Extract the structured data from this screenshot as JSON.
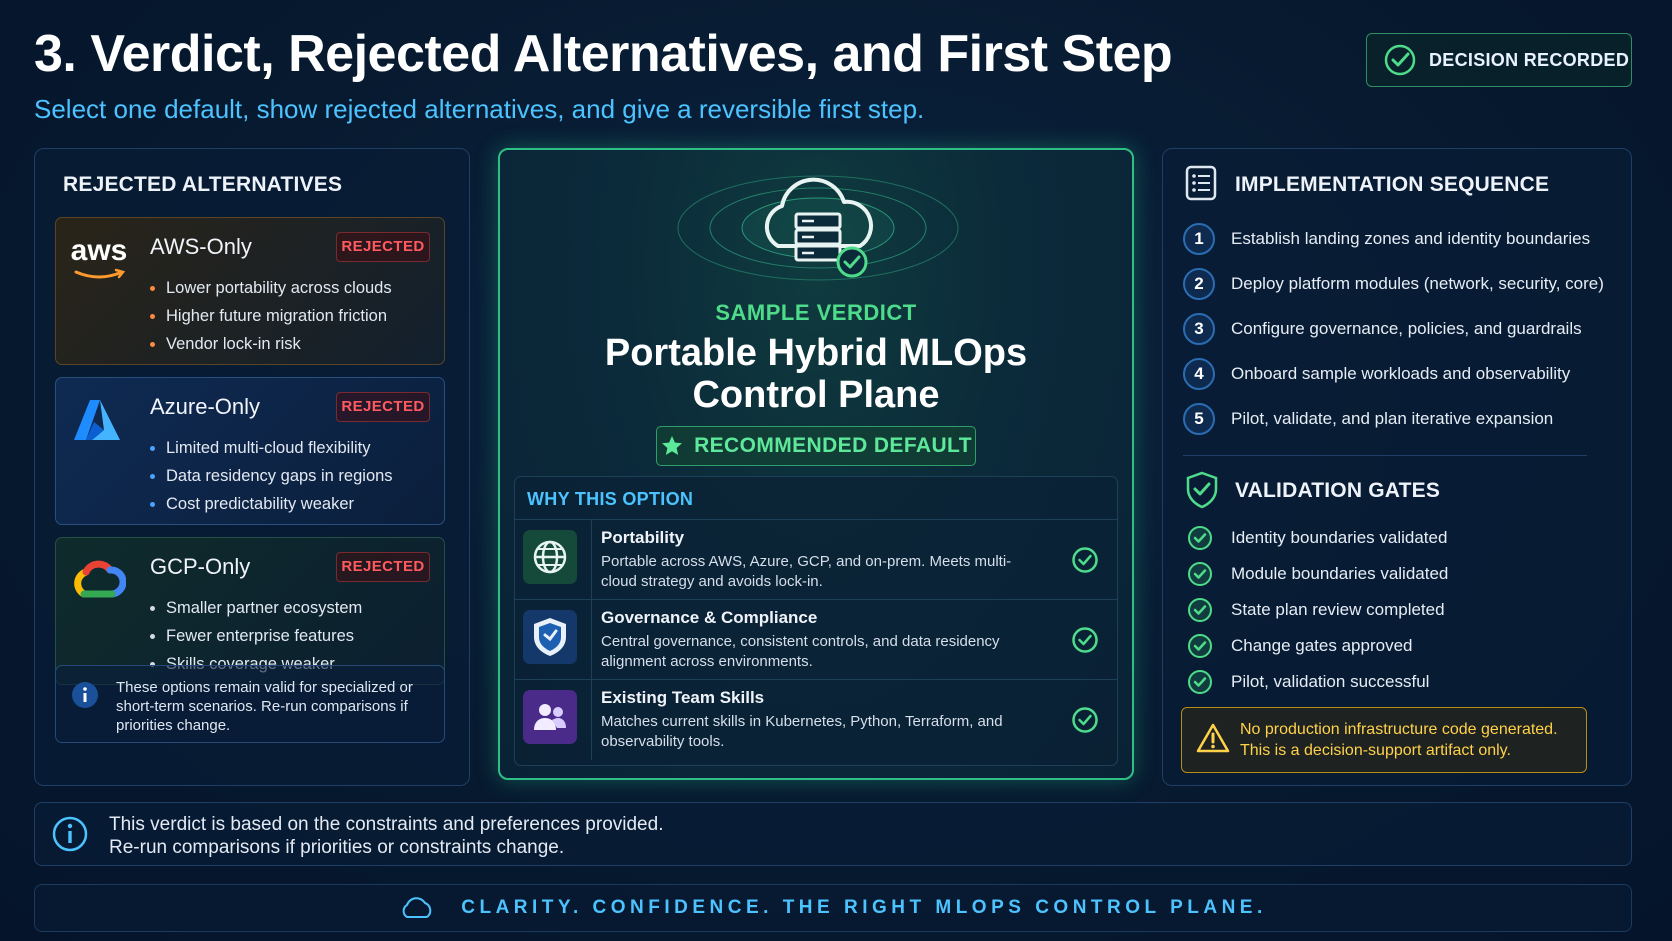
{
  "header": {
    "title": "3. Verdict, Rejected Alternatives, and First Step",
    "subtitle": "Select one default, show rejected alternatives, and give a reversible first step.",
    "badge": "DECISION RECORDED"
  },
  "rejected": {
    "title": "REJECTED ALTERNATIVES",
    "tag": "REJECTED",
    "cards": [
      {
        "logo_text": "aws",
        "name": "AWS-Only",
        "bullets": [
          "Lower portability across clouds",
          "Higher future migration friction",
          "Vendor lock-in risk"
        ]
      },
      {
        "name": "Azure-Only",
        "bullets": [
          "Limited multi-cloud flexibility",
          "Data residency gaps in regions",
          "Cost predictability weaker"
        ]
      },
      {
        "name": "GCP-Only",
        "bullets": [
          "Smaller partner ecosystem",
          "Fewer enterprise features",
          "Skills coverage weaker"
        ]
      }
    ],
    "note": "These options remain valid for specialized or short-term scenarios. Re-run comparisons if priorities change."
  },
  "verdict": {
    "label": "SAMPLE VERDICT",
    "title_line1": "Portable Hybrid MLOps",
    "title_line2": "Control Plane",
    "recommended": "RECOMMENDED DEFAULT",
    "why_title": "WHY THIS OPTION",
    "reasons": [
      {
        "icon": "globe-icon",
        "name": "Portability",
        "desc": "Portable across AWS, Azure, GCP, and on-prem. Meets multi-cloud strategy and avoids lock-in."
      },
      {
        "icon": "shield-icon",
        "name": "Governance & Compliance",
        "desc": "Central governance, consistent controls, and data residency alignment across environments."
      },
      {
        "icon": "team-icon",
        "name": "Existing Team Skills",
        "desc": "Matches current skills in Kubernetes, Python, Terraform, and observability tools."
      }
    ]
  },
  "implementation": {
    "title": "IMPLEMENTATION SEQUENCE",
    "steps": [
      {
        "num": "1",
        "text": "Establish landing zones and identity boundaries"
      },
      {
        "num": "2",
        "text": "Deploy platform modules (network, security, core)"
      },
      {
        "num": "3",
        "text": "Configure governance, policies, and guardrails"
      },
      {
        "num": "4",
        "text": "Onboard sample workloads and observability"
      },
      {
        "num": "5",
        "text": "Pilot, validate, and plan iterative expansion"
      }
    ]
  },
  "gates": {
    "title": "VALIDATION GATES",
    "items": [
      "Identity boundaries validated",
      "Module boundaries validated",
      "State plan review completed",
      "Change gates approved",
      "Pilot, validation successful"
    ]
  },
  "warning": {
    "line1": "No production infrastructure code generated.",
    "line2": "This is a decision-support artifact only."
  },
  "footer": {
    "info_line1": "This verdict is based on the constraints and preferences provided.",
    "info_line2": "Re-run comparisons if priorities or constraints change.",
    "tagline": "CLARITY.  CONFIDENCE.  THE RIGHT MLOPS CONTROL PLANE."
  },
  "colors": {
    "accent_blue": "#4cc3ff",
    "accent_green": "#4fdc8a",
    "rejected_red": "#ff5a5f",
    "warning_yellow": "#ffd24a"
  }
}
